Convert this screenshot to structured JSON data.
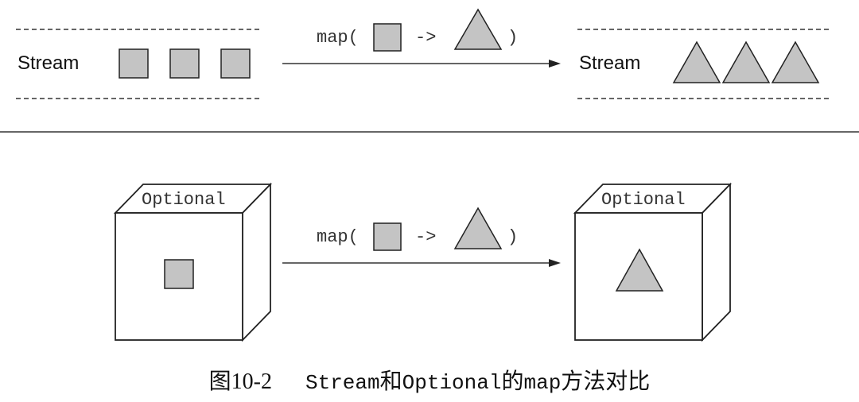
{
  "stream_section": {
    "left_label": "Stream",
    "right_label": "Stream",
    "map_label_prefix": "map(",
    "map_label_arrow": "->",
    "map_label_suffix": ")"
  },
  "optional_section": {
    "left_box_label": "Optional",
    "right_box_label": "Optional",
    "map_label_prefix": "map(",
    "map_label_arrow": "->",
    "map_label_suffix": ")"
  },
  "caption": {
    "figure_number": "图10-2",
    "text_part1": "Stream",
    "text_part2": "和",
    "text_part3": "Optional",
    "text_part4": "的",
    "text_part5": "map",
    "text_part6": "方法对比"
  },
  "colors": {
    "shape_fill": "#c4c4c4",
    "stroke": "#222222",
    "background": "#ffffff"
  }
}
